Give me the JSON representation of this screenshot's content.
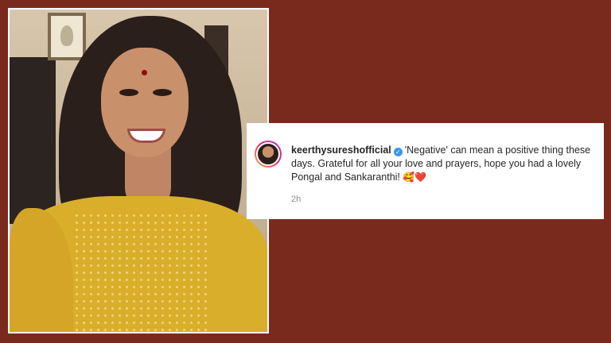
{
  "post": {
    "username": "keerthysureshofficial",
    "caption": "'Negative' can mean a positive thing these days. Grateful for all your love and prayers, hope you had a lovely Pongal and Sankaranthi!",
    "emojis": "🥰❤️",
    "timestamp": "2h"
  },
  "icons": {
    "verified_badge": "verified-check-icon",
    "avatar": "profile-avatar"
  },
  "colors": {
    "background": "#7a2a1c",
    "verified": "#3897f0",
    "username": "#262626",
    "timestamp": "#8e8e8e"
  }
}
